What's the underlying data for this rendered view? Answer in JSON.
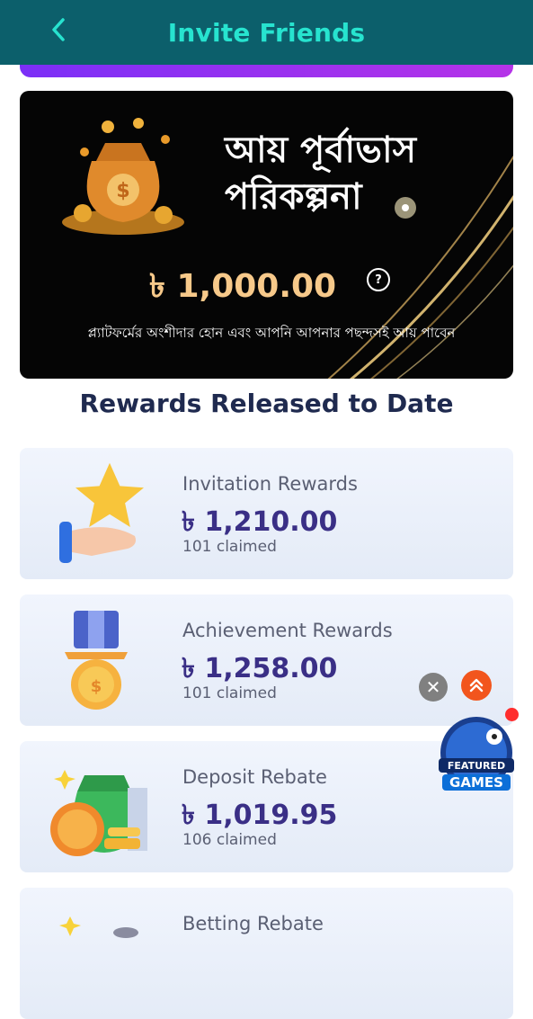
{
  "header": {
    "title": "Invite Friends"
  },
  "banner": {
    "title_line1": "আয় পূর্বাভাস",
    "title_line2": "পরিকল্পনা",
    "amount": "৳ 1,000.00",
    "help_symbol": "?",
    "description": "প্ল্যাটফর্মের অংশীদার হোন এবং আপনি আপনার পছন্দসই আয় পাবেন"
  },
  "section_title": "Rewards Released to Date",
  "rewards": [
    {
      "label": "Invitation Rewards",
      "value": "৳ 1,210.00",
      "claimed": "101 claimed",
      "icon": "star-hand-icon"
    },
    {
      "label": "Achievement Rewards",
      "value": "৳ 1,258.00",
      "claimed": "101 claimed",
      "icon": "medal-icon"
    },
    {
      "label": "Deposit Rebate",
      "value": "৳ 1,019.95",
      "claimed": "106 claimed",
      "icon": "money-bag-icon"
    },
    {
      "label": "Betting Rebate",
      "icon": "gift-icon"
    }
  ],
  "floating": {
    "close_symbol": "✕",
    "featured_line1": "FEATURED",
    "featured_line2": "GAMES"
  },
  "colors": {
    "header_bg": "#0c5f6b",
    "header_title": "#27e3cf",
    "amount_gold": "#f7c98a",
    "reward_value": "#3a2f86",
    "section_title": "#1f2a4f"
  }
}
